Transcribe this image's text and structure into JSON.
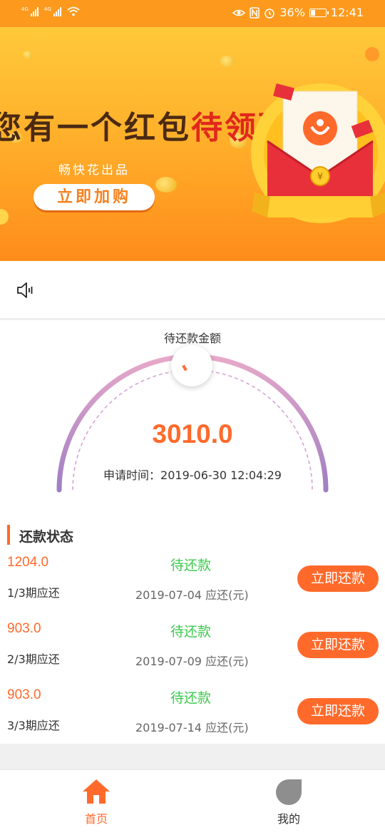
{
  "status_bar": {
    "signal1": "4G",
    "signal2": "4G",
    "battery_percent": "36%",
    "battery_level": 0.36,
    "time": "12:41"
  },
  "banner": {
    "title_prefix": "您有一个红包",
    "title_highlight": "待领取",
    "subtitle": "畅快花出品",
    "button_label": "立即加购"
  },
  "notice": {
    "icon": "speaker-icon"
  },
  "gauge": {
    "label": "待还款金额",
    "amount": "3010.0",
    "apply_time_label": "申请时间：",
    "apply_time": "2019-06-30 12:04:29"
  },
  "repayment": {
    "title": "还款状态",
    "items": [
      {
        "amount": "1204.0",
        "status": "待还款",
        "term": "1/3期应还",
        "due": "2019-07-04 应还(元)",
        "button": "立即还款"
      },
      {
        "amount": "903.0",
        "status": "待还款",
        "term": "2/3期应还",
        "due": "2019-07-09 应还(元)",
        "button": "立即还款"
      },
      {
        "amount": "903.0",
        "status": "待还款",
        "term": "3/3期应还",
        "due": "2019-07-14 应还(元)",
        "button": "立即还款"
      }
    ]
  },
  "nav": {
    "home": {
      "label": "首页",
      "icon": "home-icon"
    },
    "mine": {
      "label": "我的",
      "icon": "profile-icon"
    }
  },
  "colors": {
    "accent": "#ff6a2b",
    "status_green": "#3cc94f",
    "status_bar": "#fd9a1d"
  }
}
